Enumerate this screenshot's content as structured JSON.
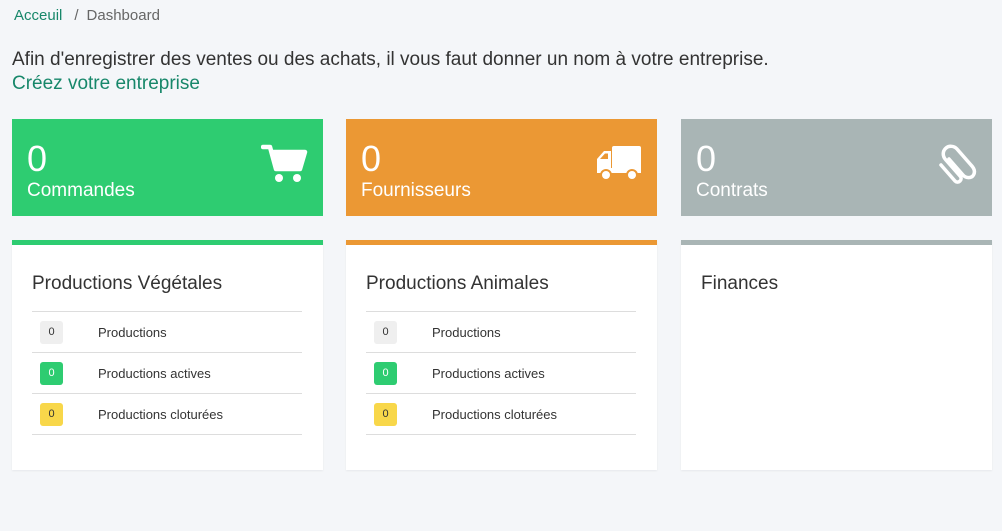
{
  "breadcrumb": {
    "home": "Acceuil",
    "separator": "/",
    "current": "Dashboard"
  },
  "notice": {
    "text": "Afin d'enregistrer des ventes ou des achats, il vous faut donner un nom à votre entreprise.",
    "link": "Créez votre entreprise"
  },
  "stats": [
    {
      "value": "0",
      "label": "Commandes",
      "icon": "cart-icon",
      "color": "#2ecc71"
    },
    {
      "value": "0",
      "label": "Fournisseurs",
      "icon": "truck-icon",
      "color": "#eb9834"
    },
    {
      "value": "0",
      "label": "Contrats",
      "icon": "paperclip-icon",
      "color": "#a9b5b5"
    }
  ],
  "panels": [
    {
      "title": "Productions Végétales",
      "rows": [
        {
          "badge": "0",
          "label": "Productions"
        },
        {
          "badge": "0",
          "label": "Productions actives"
        },
        {
          "badge": "0",
          "label": "Productions cloturées"
        }
      ]
    },
    {
      "title": "Productions Animales",
      "rows": [
        {
          "badge": "0",
          "label": "Productions"
        },
        {
          "badge": "0",
          "label": "Productions actives"
        },
        {
          "badge": "0",
          "label": "Productions cloturées"
        }
      ]
    },
    {
      "title": "Finances"
    }
  ]
}
